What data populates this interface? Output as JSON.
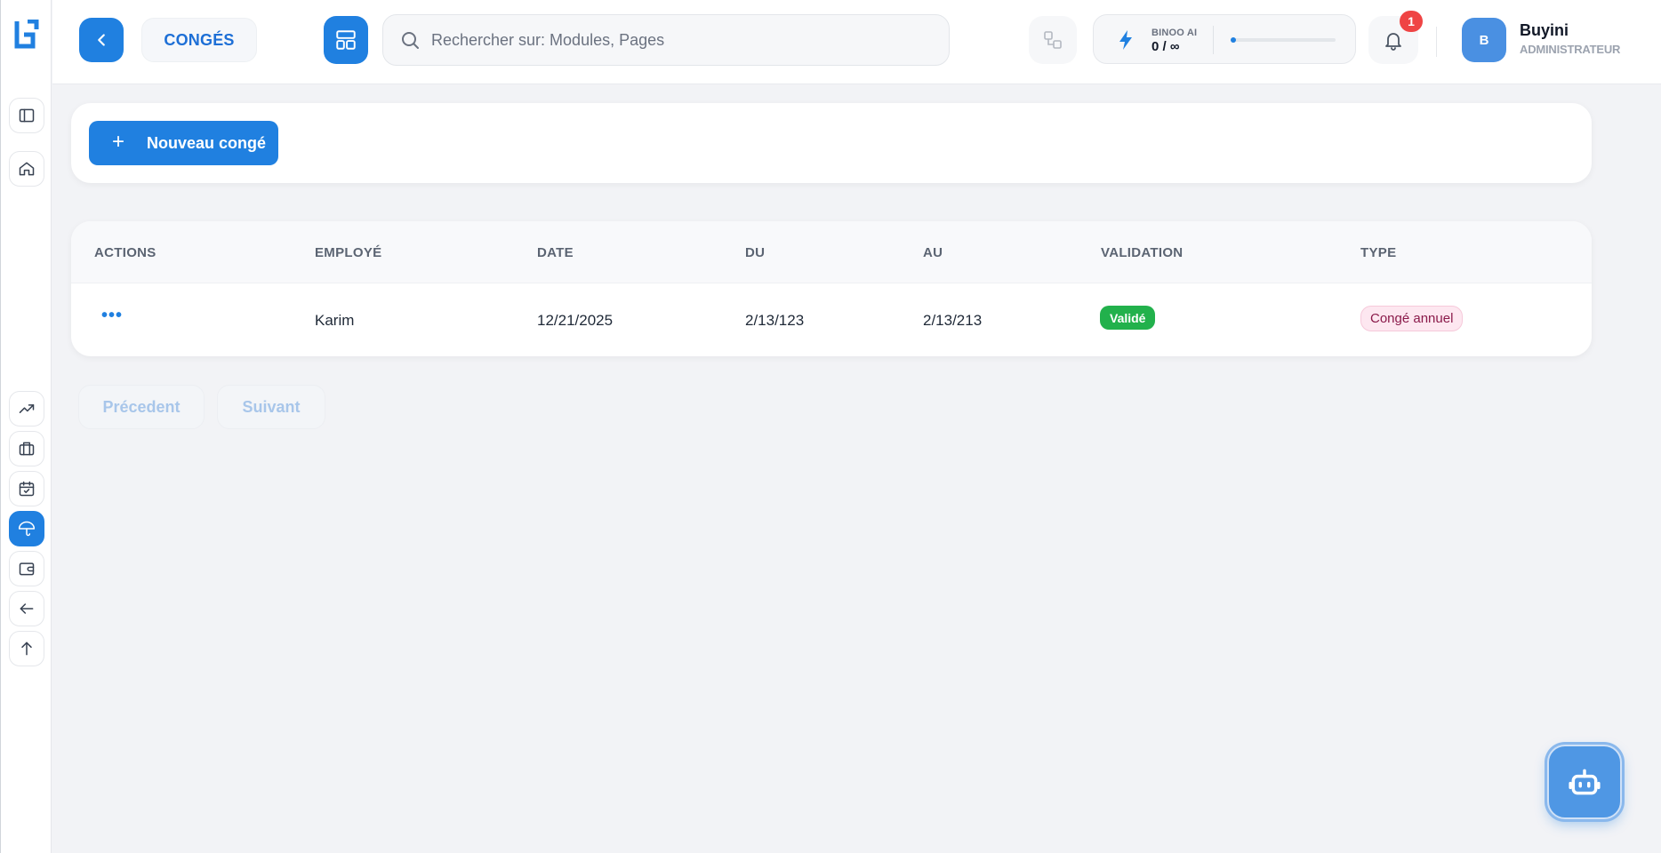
{
  "header": {
    "page_title": "CONGÉS",
    "search": {
      "placeholder": "Rechercher sur: Modules, Pages",
      "value": ""
    },
    "ai": {
      "label": "BINOO AI",
      "count": "0 / ∞",
      "usage_fraction": 0.05
    },
    "notifications": {
      "count": "1"
    },
    "user": {
      "initial": "B",
      "name": "Buyini",
      "role": "ADMINISTRATEUR"
    }
  },
  "sidebar": {
    "items": [
      {
        "name": "sidebar-toggle",
        "icon": "sidebar-panel-icon"
      },
      {
        "name": "home",
        "icon": "home-icon"
      },
      {
        "name": "analytics",
        "icon": "trending-up-icon"
      },
      {
        "name": "briefcase",
        "icon": "briefcase-icon"
      },
      {
        "name": "calendar",
        "icon": "calendar-check-icon"
      },
      {
        "name": "leave",
        "icon": "umbrella-icon",
        "active": true
      },
      {
        "name": "wallet",
        "icon": "wallet-icon"
      },
      {
        "name": "back",
        "icon": "arrow-left-icon"
      },
      {
        "name": "up",
        "icon": "arrow-up-icon"
      }
    ]
  },
  "toolbar": {
    "new_label": "Nouveau congé",
    "plus": "+"
  },
  "table": {
    "columns": [
      "ACTIONS",
      "EMPLOYÉ",
      "DATE",
      "DU",
      "AU",
      "VALIDATION",
      "TYPE"
    ],
    "rows": [
      {
        "actions": "•••",
        "employee": "Karim",
        "date": "12/21/2025",
        "from": "2/13/123",
        "to": "2/13/213",
        "validation": "Validé",
        "type": "Congé annuel"
      }
    ]
  },
  "pagination": {
    "prev_label": "Précedent",
    "next_label": "Suivant"
  },
  "colors": {
    "accent": "#2080e0",
    "valid": "#22b14c",
    "type_tag_bg": "#fde7f0",
    "badge": "#ef4444"
  }
}
